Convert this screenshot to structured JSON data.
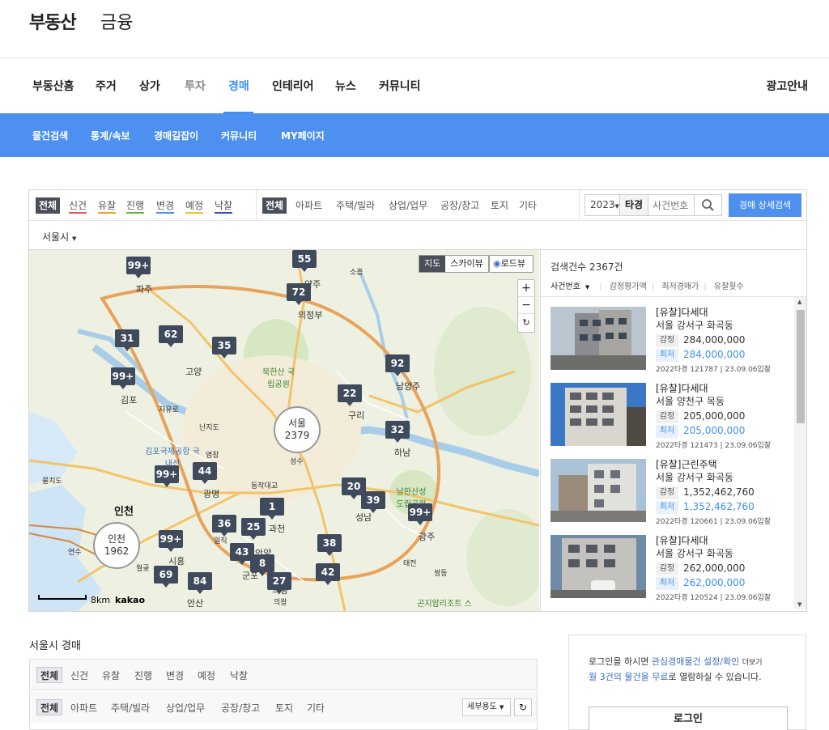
{
  "logo": {
    "main": "부동산",
    "sub": "금융"
  },
  "gnb": {
    "items": [
      "부동산홈",
      "주거",
      "상가",
      "투자",
      "경매",
      "인테리어",
      "뉴스",
      "커뮤니티"
    ],
    "right": "광고안내"
  },
  "lnb": {
    "items": [
      "물건검색",
      "통계/속보",
      "경매길잡이",
      "커뮤니티",
      "MY페이지"
    ]
  },
  "status_filter": {
    "all": "전체",
    "items": [
      "신건",
      "유찰",
      "진행",
      "변경",
      "예정",
      "낙찰"
    ]
  },
  "type_filter": {
    "all": "전체",
    "items": [
      "아파트",
      "주택/빌라",
      "상업/업무",
      "공장/창고",
      "토지",
      "기타"
    ]
  },
  "search": {
    "year": "2023",
    "court_type": "타경",
    "case_placeholder": "사건번호",
    "detail_button": "경매 상세검색"
  },
  "city_select": "서울시",
  "map": {
    "toggle_map": "지도",
    "toggle_sky": "스카이뷰",
    "roadview": "로드뷰",
    "zoom_in": "+",
    "zoom_out": "−",
    "reset": "↻",
    "scale": "8km",
    "brand": "kakao",
    "markers": [
      "99+",
      "55",
      "72",
      "31",
      "62",
      "35",
      "99+",
      "92",
      "22",
      "32",
      "44",
      "99+",
      "20",
      "39",
      "99+",
      "1",
      "36",
      "25",
      "99+",
      "38",
      "43",
      "8",
      "69",
      "84",
      "27",
      "42"
    ],
    "clusters": [
      {
        "name": "서울",
        "count": "2379"
      },
      {
        "name": "인천",
        "count": "1962"
      }
    ],
    "places": [
      "파주",
      "양주",
      "의정부",
      "고양",
      "남양주",
      "김포",
      "구리",
      "하남",
      "광명",
      "성남",
      "인천",
      "과천",
      "광주",
      "시흥",
      "안양",
      "안산",
      "군포",
      "의왕",
      "북한산 국립공원",
      "남한산성 도립공원",
      "김포국제공항 국내선",
      "곤지암리조트 스키장",
      "소흘",
      "물치도",
      "연수",
      "월곶",
      "태전",
      "쌍동",
      "자유로",
      "난지도",
      "염창",
      "성수",
      "동작대교",
      "일직",
      "의왕"
    ]
  },
  "result": {
    "count_text": "검색건수 2367건",
    "sort": [
      "사건번호",
      "감정평가액",
      "최저경매가",
      "유찰횟수"
    ],
    "label_appraisal": "감정",
    "label_min": "최저",
    "items": [
      {
        "title": "[유찰]다세대",
        "address": "서울 강서구 화곡동",
        "appraisal": "284,000,000",
        "minimum": "284,000,000",
        "case": "2022타경 121787",
        "date": "23.09.06입찰"
      },
      {
        "title": "[유찰]다세대",
        "address": "서울 양천구 목동",
        "appraisal": "205,000,000",
        "minimum": "205,000,000",
        "case": "2022타경 121473",
        "date": "23.09.06입찰"
      },
      {
        "title": "[유찰]근린주택",
        "address": "서울 강서구 화곡동",
        "appraisal": "1,352,462,760",
        "minimum": "1,352,462,760",
        "case": "2022타경 120661",
        "date": "23.09.06입찰"
      },
      {
        "title": "[유찰]다세대",
        "address": "서울 강서구 화곡동",
        "appraisal": "262,000,000",
        "minimum": "262,000,000",
        "case": "2022타경 120524",
        "date": "23.09.06입찰"
      }
    ]
  },
  "section": {
    "title": "서울시 경매",
    "status": {
      "all": "전체",
      "items": [
        "신건",
        "유찰",
        "진행",
        "변경",
        "예정",
        "낙찰"
      ]
    },
    "types": {
      "all": "전체",
      "items": [
        "아파트",
        "주택/빌라",
        "상업/업무",
        "공장/창고",
        "토지",
        "기타"
      ]
    },
    "use_select": "세부용도",
    "refresh": "↻"
  },
  "login": {
    "msg_prefix": "로그인을 하시면 ",
    "msg_link1": "관심경매물건 설정/확인",
    "msg_more": "더보기",
    "msg_link2": "월 3건의 물건을 무료",
    "msg_suffix": "로 열람하실 수 있습니다.",
    "button": "로그인"
  },
  "colors": {
    "accent": "#4d90f0",
    "status_new": "#e45a5a",
    "status_fail": "#f0a030",
    "status_progress": "#6bb04a",
    "status_change": "#4d90f0",
    "status_plan": "#f0c030",
    "status_sold": "#3355aa"
  }
}
